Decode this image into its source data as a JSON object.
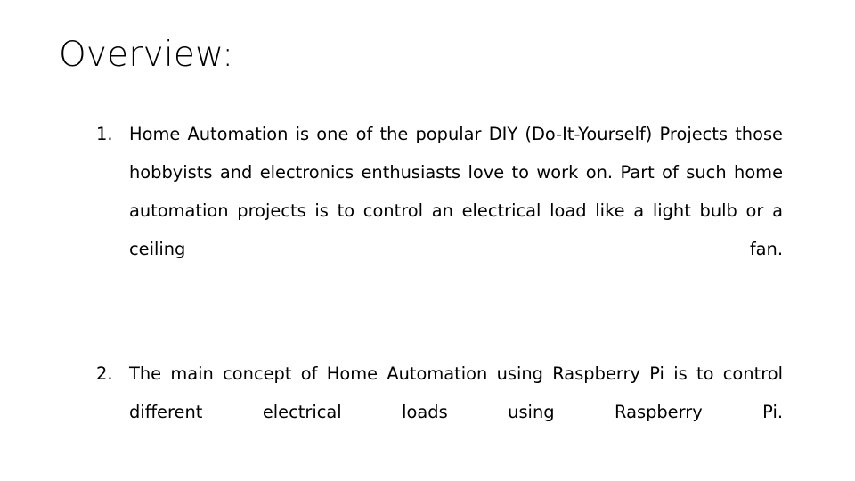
{
  "slide": {
    "title": "Overview:",
    "background_color": "#ffffff",
    "text_color": "#000000",
    "items": [
      {
        "marker": "1.",
        "text": "Home Automation is one of the popular DIY (Do-It-Yourself) Projects those hobbyists and electronics enthusiasts love to work on. Part of such home automation projects is to control an electrical load like a light bulb or a ceiling fan."
      },
      {
        "marker": "2.",
        "text": "The main concept of Home Automation using Raspberry Pi is to control different electrical loads using Raspberry Pi."
      }
    ]
  }
}
